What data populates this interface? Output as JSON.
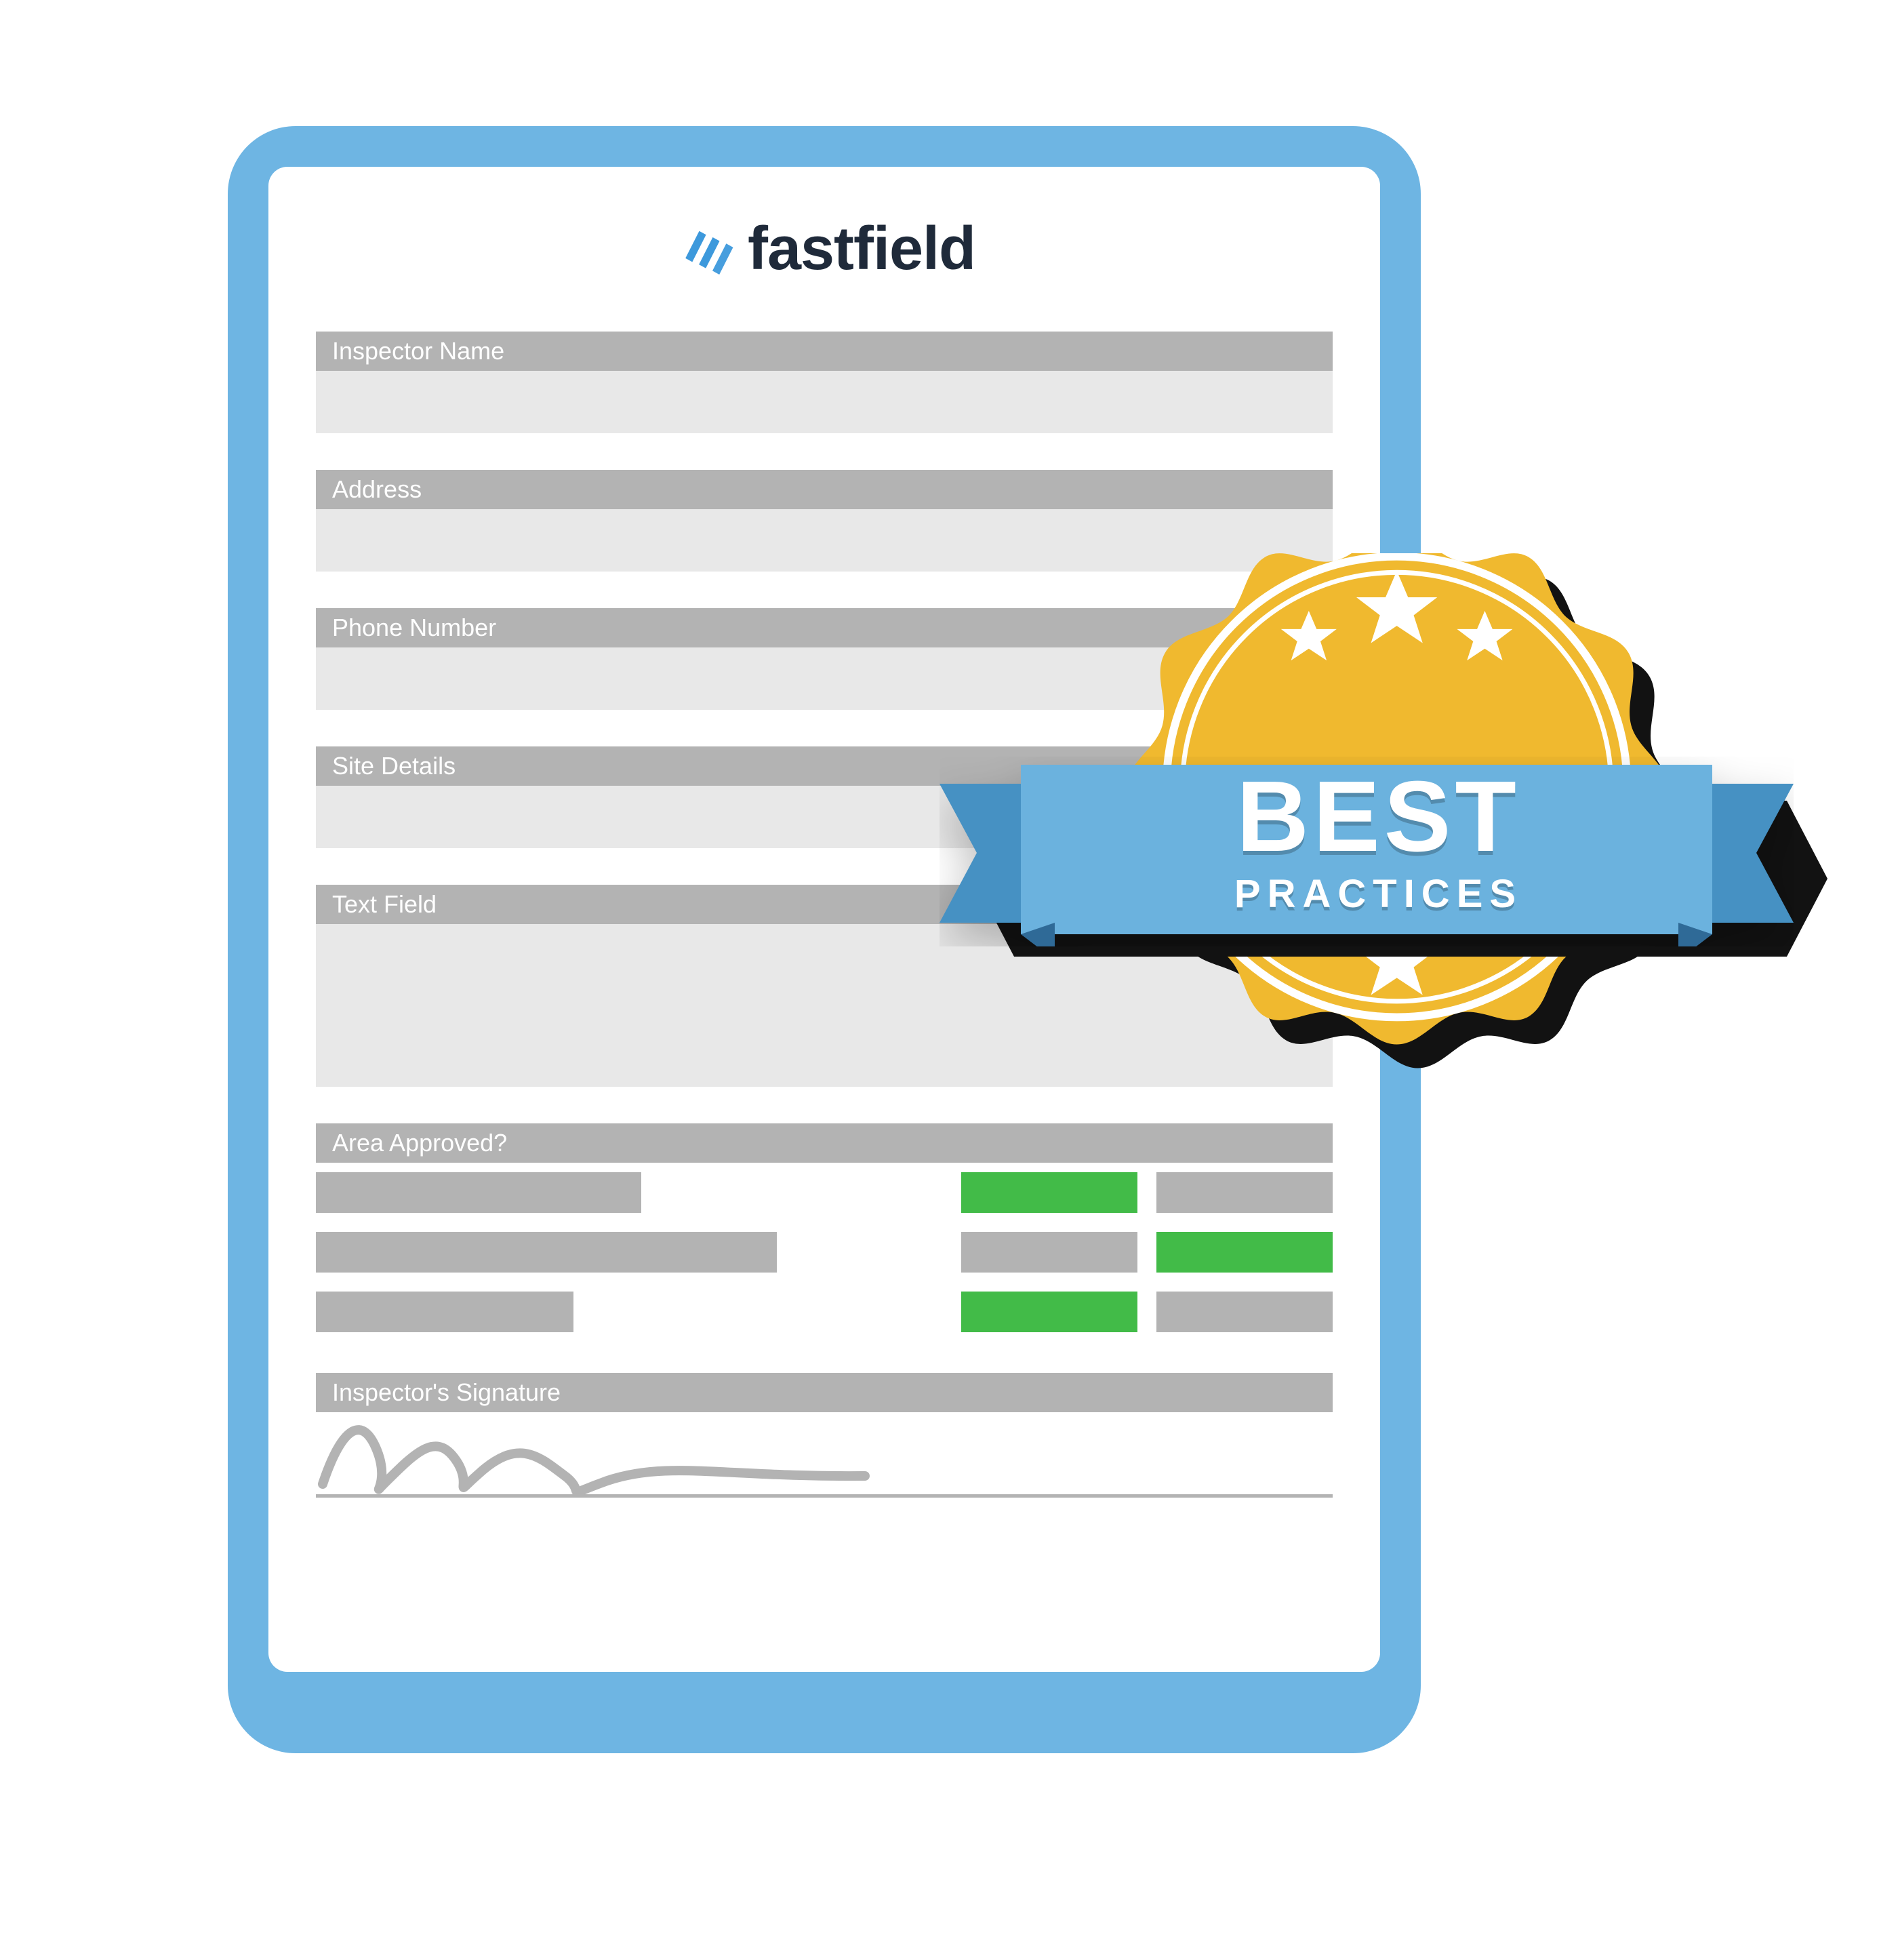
{
  "brand": {
    "name": "fastfield",
    "accent": "#3d99dc"
  },
  "fields": {
    "inspector_name": {
      "label": "Inspector Name"
    },
    "address": {
      "label": "Address"
    },
    "phone": {
      "label": "Phone Number"
    },
    "site_details": {
      "label": "Site Details"
    },
    "text_field": {
      "label": "Text Field"
    },
    "area_approved": {
      "label": "Area Approved?"
    },
    "signature": {
      "label": "Inspector's Signature"
    }
  },
  "approved_options": {
    "row1": [
      "green",
      "gray"
    ],
    "row2": [
      "gray",
      "green"
    ],
    "row3": [
      "green",
      "gray"
    ]
  },
  "badge": {
    "line1": "BEST",
    "line2": "PRACTICES",
    "seal_color": "#f0b92f",
    "ribbon_color": "#6bb2de",
    "ribbon_dark": "#4691c3"
  }
}
